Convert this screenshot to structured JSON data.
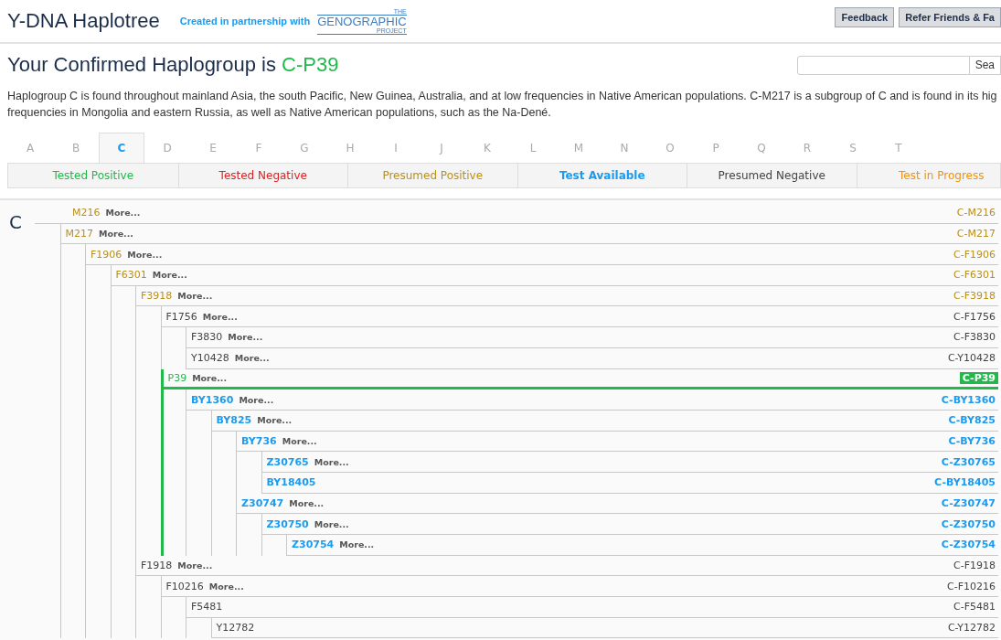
{
  "header": {
    "title": "Y-DNA Haplotree",
    "partnership": "Created in partnership with",
    "logo": {
      "top": "THE",
      "main": "GENOGRAPHIC",
      "bottom": "PROJECT"
    },
    "buttons": [
      "Feedback",
      "Refer Friends & Fa"
    ]
  },
  "heading": {
    "text": "Your Confirmed Haplogroup is ",
    "haplogroup": "C-P39"
  },
  "search": {
    "button": "Sea"
  },
  "description": [
    "Haplogroup C is found throughout mainland Asia, the south Pacific, New Guinea, Australia, and at low frequencies in Native American populations. C-M217 is a subgroup of C and is found in its hig",
    "frequencies in Mongolia and eastern Russia, as well as Native American populations, such as the Na-Dené."
  ],
  "letter_tabs": [
    {
      "label": "A",
      "selected": false
    },
    {
      "label": "B",
      "selected": false
    },
    {
      "label": "C",
      "selected": true
    },
    {
      "label": "D",
      "selected": false
    },
    {
      "label": "E",
      "selected": false
    },
    {
      "label": "F",
      "selected": false
    },
    {
      "label": "G",
      "selected": false
    },
    {
      "label": "H",
      "selected": false
    },
    {
      "label": "I",
      "selected": false
    },
    {
      "label": "J",
      "selected": false
    },
    {
      "label": "K",
      "selected": false
    },
    {
      "label": "L",
      "selected": false
    },
    {
      "label": "M",
      "selected": false
    },
    {
      "label": "N",
      "selected": false
    },
    {
      "label": "O",
      "selected": false
    },
    {
      "label": "P",
      "selected": false
    },
    {
      "label": "Q",
      "selected": false
    },
    {
      "label": "R",
      "selected": false
    },
    {
      "label": "S",
      "selected": false
    },
    {
      "label": "T",
      "selected": false
    }
  ],
  "legend": [
    {
      "label": "Tested Positive",
      "kind": "positive"
    },
    {
      "label": "Tested Negative",
      "kind": "negative"
    },
    {
      "label": "Presumed Positive",
      "kind": "presumed_positive"
    },
    {
      "label": "Test Available",
      "kind": "available"
    },
    {
      "label": "Presumed Negative",
      "kind": "presumed_negative"
    },
    {
      "label": "Test in Progress",
      "kind": "in_progress"
    }
  ],
  "tree": {
    "root_label": "C",
    "nodes": [
      {
        "name": "M216",
        "more": "More...",
        "haplogroup": "C-M216",
        "kind": "presumed_positive",
        "selected": false,
        "children": [
          {
            "name": "M217",
            "more": "More...",
            "haplogroup": "C-M217",
            "kind": "presumed_positive",
            "selected": false,
            "children": [
              {
                "name": "F1906",
                "more": "More...",
                "haplogroup": "C-F1906",
                "kind": "presumed_positive",
                "selected": false,
                "children": [
                  {
                    "name": "F6301",
                    "more": "More...",
                    "haplogroup": "C-F6301",
                    "kind": "presumed_positive",
                    "selected": false,
                    "children": [
                      {
                        "name": "F3918",
                        "more": "More...",
                        "haplogroup": "C-F3918",
                        "kind": "presumed_positive",
                        "selected": false,
                        "children": [
                          {
                            "name": "F1756",
                            "more": "More...",
                            "haplogroup": "C-F1756",
                            "kind": "presumed_negative",
                            "selected": false,
                            "children": [
                              {
                                "name": "F3830",
                                "more": "More...",
                                "haplogroup": "C-F3830",
                                "kind": "presumed_negative",
                                "selected": false
                              },
                              {
                                "name": "Y10428",
                                "more": "More...",
                                "haplogroup": "C-Y10428",
                                "kind": "presumed_negative",
                                "selected": false
                              }
                            ]
                          },
                          {
                            "name": "P39",
                            "more": "More...",
                            "haplogroup": "C-P39",
                            "kind": "positive",
                            "selected": true,
                            "children": [
                              {
                                "name": "BY1360",
                                "more": "More...",
                                "haplogroup": "C-BY1360",
                                "kind": "available",
                                "selected": false,
                                "children": [
                                  {
                                    "name": "BY825",
                                    "more": "More...",
                                    "haplogroup": "C-BY825",
                                    "kind": "available",
                                    "selected": false,
                                    "children": [
                                      {
                                        "name": "BY736",
                                        "more": "More...",
                                        "haplogroup": "C-BY736",
                                        "kind": "available",
                                        "selected": false,
                                        "children": [
                                          {
                                            "name": "Z30765",
                                            "more": "More...",
                                            "haplogroup": "C-Z30765",
                                            "kind": "available",
                                            "selected": false
                                          },
                                          {
                                            "name": "BY18405",
                                            "haplogroup": "C-BY18405",
                                            "kind": "available",
                                            "selected": false
                                          }
                                        ]
                                      },
                                      {
                                        "name": "Z30747",
                                        "more": "More...",
                                        "haplogroup": "C-Z30747",
                                        "kind": "available",
                                        "selected": false,
                                        "children": [
                                          {
                                            "name": "Z30750",
                                            "more": "More...",
                                            "haplogroup": "C-Z30750",
                                            "kind": "available",
                                            "selected": false,
                                            "children": [
                                              {
                                                "name": "Z30754",
                                                "more": "More...",
                                                "haplogroup": "C-Z30754",
                                                "kind": "available",
                                                "selected": false
                                              }
                                            ]
                                          }
                                        ]
                                      }
                                    ]
                                  }
                                ]
                              }
                            ]
                          }
                        ]
                      },
                      {
                        "name": "F1918",
                        "more": "More...",
                        "haplogroup": "C-F1918",
                        "kind": "presumed_negative",
                        "selected": false,
                        "children": [
                          {
                            "name": "F10216",
                            "more": "More...",
                            "haplogroup": "C-F10216",
                            "kind": "presumed_negative",
                            "selected": false,
                            "children": [
                              {
                                "name": "F5481",
                                "haplogroup": "C-F5481",
                                "kind": "presumed_negative",
                                "selected": false,
                                "children": [
                                  {
                                    "name": "Y12782",
                                    "haplogroup": "C-Y12782",
                                    "kind": "presumed_negative",
                                    "selected": false
                                  }
                                ]
                              }
                            ]
                          }
                        ]
                      }
                    ]
                  }
                ]
              }
            ]
          }
        ]
      }
    ]
  }
}
